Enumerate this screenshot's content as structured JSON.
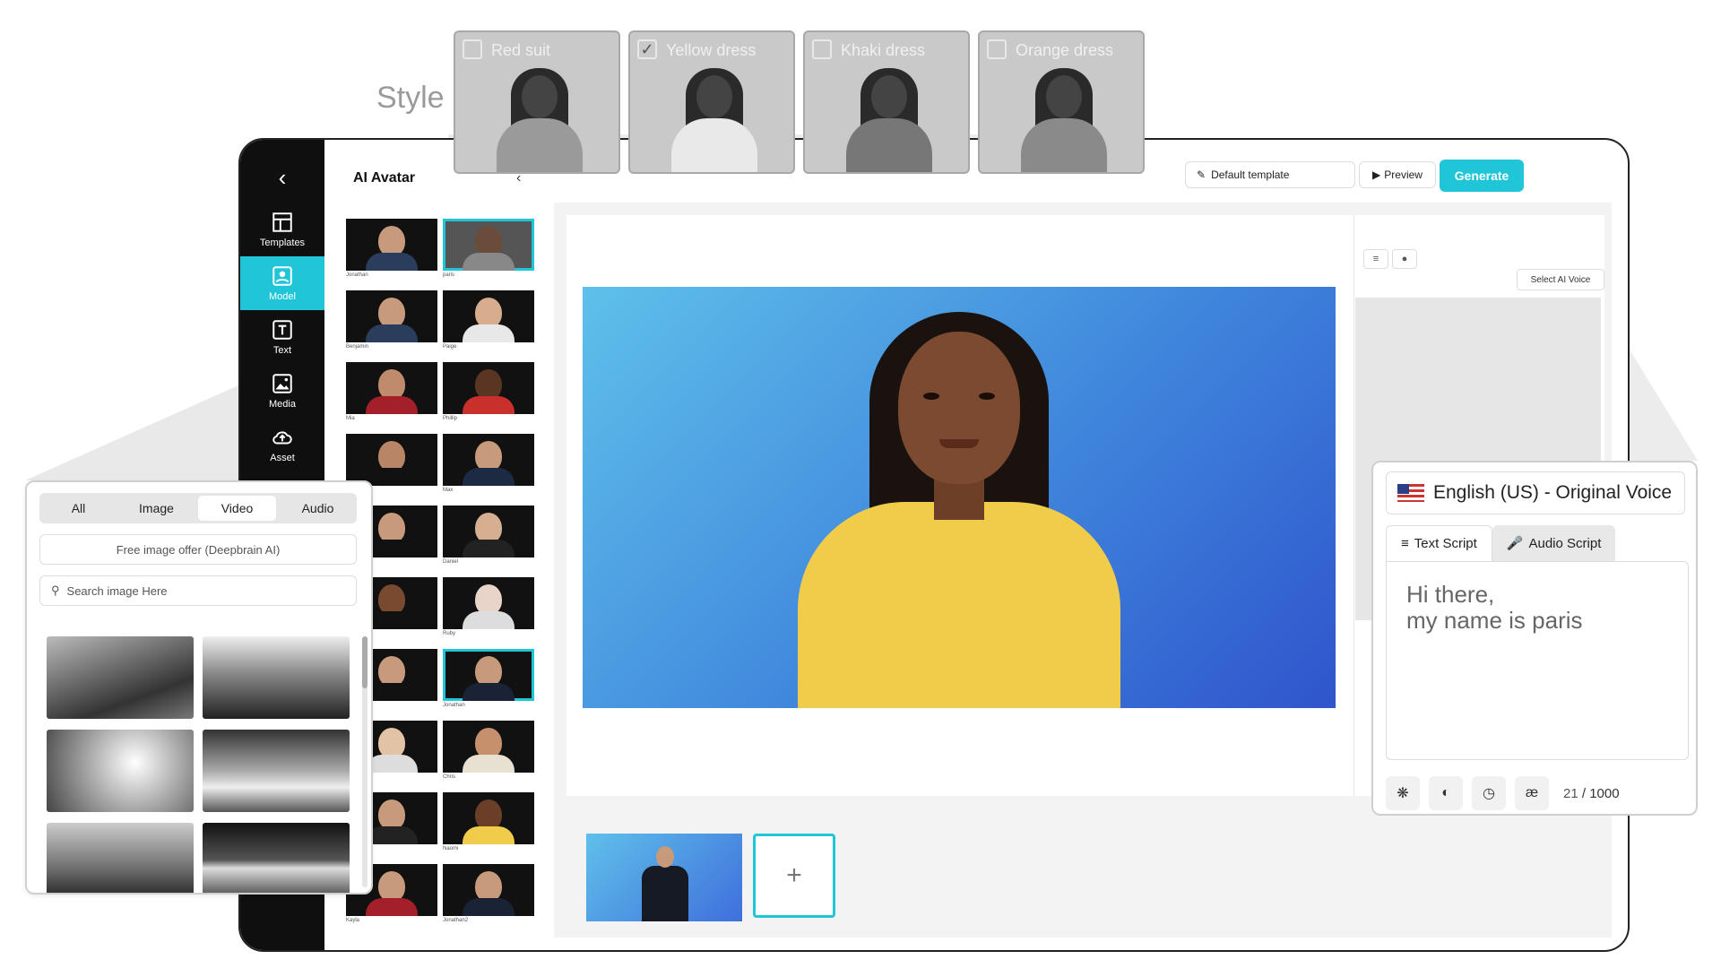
{
  "style_section": {
    "label": "Style",
    "options": [
      {
        "label": "Red suit",
        "checked": false
      },
      {
        "label": "Yellow dress",
        "checked": true
      },
      {
        "label": "Khaki dress",
        "checked": false
      },
      {
        "label": "Orange dress",
        "checked": false
      }
    ]
  },
  "sidebar": {
    "back_icon": "chevron-left-icon",
    "items": [
      {
        "label": "Templates",
        "icon": "templates-icon",
        "active": false
      },
      {
        "label": "Model",
        "icon": "model-icon",
        "active": true
      },
      {
        "label": "Text",
        "icon": "text-icon",
        "active": false
      },
      {
        "label": "Media",
        "icon": "media-icon",
        "active": false
      },
      {
        "label": "Asset",
        "icon": "upload-cloud-icon",
        "active": false
      }
    ]
  },
  "avatar_panel": {
    "title": "AI Avatar",
    "avatars": [
      "Jonathan",
      "paris",
      "Benjamin",
      "Paige",
      "Mia",
      "Phillip",
      "",
      "Max",
      "",
      "Daniel",
      "",
      "Ruby",
      "",
      "Jonathan",
      "",
      "Chris",
      "",
      "Naomi",
      "Kayla",
      "Jonathan2"
    ]
  },
  "toolbar": {
    "template_label": "Default template",
    "preview_label": "Preview",
    "generate_label": "Generate",
    "accent_color": "#20c6d8"
  },
  "script_column": {
    "select_voice_label": "Select AI Voice"
  },
  "scenes": {
    "add_label": "+"
  },
  "media_panel": {
    "tabs": [
      "All",
      "Image",
      "Video",
      "Audio"
    ],
    "active_tab": "Video",
    "offer_label": "Free image offer (Deepbrain AI)",
    "search_placeholder": "Search image Here"
  },
  "voice_panel": {
    "language": "English (US) - Original Voice",
    "tabs": [
      "Text Script",
      "Audio Script"
    ],
    "active_tab": "Text Script",
    "script_text_line1": "Hi there,",
    "script_text_line2": "my name is paris",
    "count_current": "21",
    "count_max": "/ 1000",
    "footer_icons": [
      "openai-icon",
      "speed-icon",
      "clock-icon",
      "ae-icon"
    ]
  }
}
